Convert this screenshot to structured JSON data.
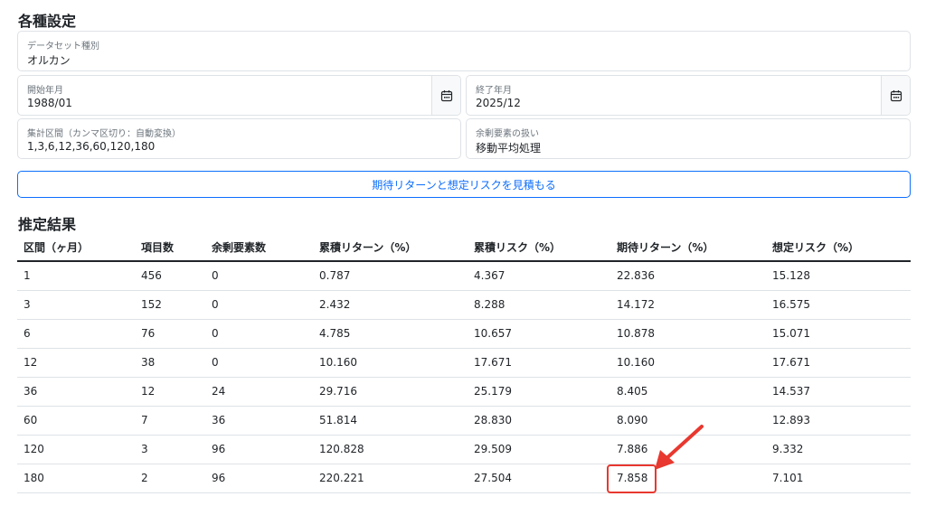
{
  "settings": {
    "title": "各種設定",
    "dataset": {
      "label": "データセット種別",
      "value": "オルカン"
    },
    "start": {
      "label": "開始年月",
      "value": "1988/01"
    },
    "end": {
      "label": "終了年月",
      "value": "2025/12"
    },
    "intervals": {
      "label": "集計区間（カンマ区切り：自動変換）",
      "value": "1,3,6,12,36,60,120,180"
    },
    "remainder": {
      "label": "余剰要素の扱い",
      "value": "移動平均処理"
    },
    "estimate_button": "期待リターンと想定リスクを見積もる"
  },
  "results": {
    "title": "推定結果",
    "columns": [
      "区間（ヶ月）",
      "項目数",
      "余剰要素数",
      "累積リターン（%）",
      "累積リスク（%）",
      "期待リターン（%）",
      "想定リスク（%）"
    ],
    "rows": [
      [
        "1",
        "456",
        "0",
        "0.787",
        "4.367",
        "22.836",
        "15.128"
      ],
      [
        "3",
        "152",
        "0",
        "2.432",
        "8.288",
        "14.172",
        "16.575"
      ],
      [
        "6",
        "76",
        "0",
        "4.785",
        "10.657",
        "10.878",
        "15.071"
      ],
      [
        "12",
        "38",
        "0",
        "10.160",
        "17.671",
        "10.160",
        "17.671"
      ],
      [
        "36",
        "12",
        "24",
        "29.716",
        "25.179",
        "8.405",
        "14.537"
      ],
      [
        "60",
        "7",
        "36",
        "51.814",
        "28.830",
        "8.090",
        "12.893"
      ],
      [
        "120",
        "3",
        "96",
        "120.828",
        "29.509",
        "7.886",
        "9.332"
      ],
      [
        "180",
        "2",
        "96",
        "220.221",
        "27.504",
        "7.858",
        "7.101"
      ]
    ]
  },
  "annotation": {
    "color": "#e8382f",
    "icon": "arrow-icon"
  },
  "colors": {
    "accent": "#0d6efd",
    "border": "#dee2e6",
    "label": "#6c757d"
  }
}
